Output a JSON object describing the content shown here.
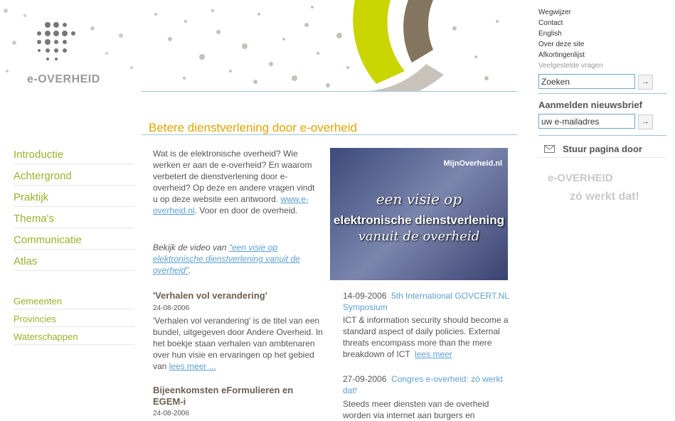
{
  "site": {
    "logo_text": "e-OVERHEID"
  },
  "utility_nav": [
    "Wegwijzer",
    "Contact",
    "English",
    "Over deze site",
    "Afkortingenlijst",
    "Veelgestelde vragen"
  ],
  "search": {
    "value": "Zoeken",
    "go": "→"
  },
  "newsletter": {
    "title": "Aanmelden nieuwsbrief",
    "value": "uw e-mailadres",
    "go": "→"
  },
  "send_page": "Stuur pagina door",
  "promo": {
    "logo": "e-OVERHEID",
    "tagline": "zó werkt dat!"
  },
  "page_title": "Betere dienstverlening door e-overheid",
  "left_nav": [
    "Introductie",
    "Achtergrond",
    "Praktijk",
    "Thema's",
    "Communicatie",
    "Atlas"
  ],
  "left_nav2": [
    "Gemeenten",
    "Provincies",
    "Waterschappen"
  ],
  "intro": {
    "text": "Wat is de elektronische overheid? Wie werken er aan de e-overheid? En waarom verbetert de dienstverlening door e-overheid? Op deze en andere vragen vindt u op deze website een antwoord.",
    "link": "www.e-overheid.nl",
    "suffix": ". Voor en door de overheid."
  },
  "video": {
    "prefix": "Bekijk de video van ",
    "link": "\"een visie op elektronische dienstverlening vanuit de overheid\"",
    "suffix": "."
  },
  "video_image": {
    "caption": "MijnOverheid.nl",
    "line1": "een visie op",
    "line2": "elektronische dienstverlening",
    "line3": "vanuit de overheid"
  },
  "articles": [
    {
      "title": "'Verhalen vol verandering'",
      "date": "24-08-2006",
      "text": "'Verhalen vol verandering' is de titel van een bundel, uitgegeven door Andere Overheid. In het boekje staan verhalen van ambtenaren over hun visie en ervaringen op het gebied van ",
      "more": "lees meer ..."
    },
    {
      "title": "Bijeenkomsten eFormulieren en EGEM-i",
      "date": "24-08-2006"
    }
  ],
  "news": [
    {
      "date": "14-09-2006",
      "title": "5th International GOVCERT.NL Symposium",
      "text": "ICT & information security should become a standard aspect of daily policies. External threats encompass more than the mere breakdown of ICT ",
      "more": "lees meer"
    },
    {
      "date": "27-09-2006",
      "title": "Congres e-overheid: zó werkt dat!",
      "text": "Steeds meer diensten van de overheid worden via internet aan burgers en"
    }
  ]
}
